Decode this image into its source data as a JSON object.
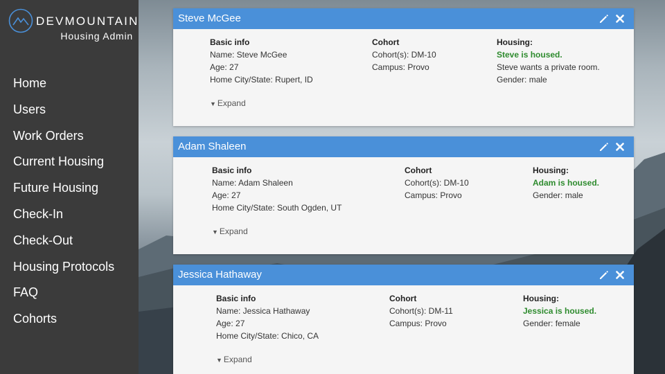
{
  "brand": {
    "name": "DEVMOUNTAIN",
    "subtitle": "Housing Admin",
    "color": "#4a90d9"
  },
  "nav": {
    "items": [
      {
        "label": "Home"
      },
      {
        "label": "Users"
      },
      {
        "label": "Work Orders"
      },
      {
        "label": "Current Housing"
      },
      {
        "label": "Future Housing"
      },
      {
        "label": "Check-In"
      },
      {
        "label": "Check-Out"
      },
      {
        "label": "Housing Protocols"
      },
      {
        "label": "FAQ"
      },
      {
        "label": "Cohorts"
      }
    ]
  },
  "labels": {
    "basic_info": "Basic info",
    "cohort": "Cohort",
    "housing": "Housing:",
    "expand": "Expand",
    "edit_icon": "pencil-icon",
    "close_icon": "close-x-icon"
  },
  "colors": {
    "header": "#4a90d9",
    "housed": "#2e8b2e",
    "sidebar": "#3b3b3b"
  },
  "cards": [
    {
      "title": "Steve McGee",
      "basic": [
        "Name: Steve McGee",
        "Age: 27",
        "Home City/State: Rupert, ID"
      ],
      "cohort": [
        "Cohort(s): DM-10",
        "Campus: Provo"
      ],
      "housing_status": "Steve is housed.",
      "housing": [
        "Steve wants a private room.",
        "Gender: male"
      ]
    },
    {
      "title": "Adam Shaleen",
      "basic": [
        "Name: Adam Shaleen",
        "Age: 27",
        "Home City/State: South Ogden, UT"
      ],
      "cohort": [
        "Cohort(s): DM-10",
        "Campus: Provo"
      ],
      "housing_status": "Adam is housed.",
      "housing": [
        "Gender: male"
      ]
    },
    {
      "title": "Jessica Hathaway",
      "basic": [
        "Name: Jessica Hathaway",
        "Age: 27",
        "Home City/State: Chico, CA"
      ],
      "cohort": [
        "Cohort(s): DM-11",
        "Campus: Provo"
      ],
      "housing_status": "Jessica is housed.",
      "housing": [
        "Gender: female"
      ]
    }
  ]
}
